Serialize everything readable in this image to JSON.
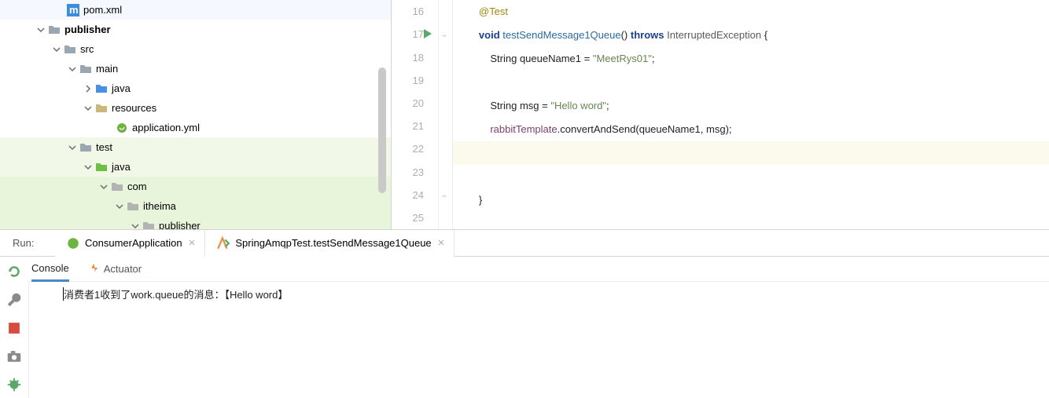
{
  "tree": {
    "pom": "pom.xml",
    "publisher": "publisher",
    "src": "src",
    "main": "main",
    "java1": "java",
    "resources": "resources",
    "app_yml": "application.yml",
    "test": "test",
    "java2": "java",
    "com": "com",
    "itheima": "itheima",
    "publisher2": "publisher"
  },
  "gutter": {
    "l16": "16",
    "l17": "17",
    "l18": "18",
    "l19": "19",
    "l20": "20",
    "l21": "21",
    "l22": "22",
    "l23": "23",
    "l24": "24",
    "l25": "25"
  },
  "code": {
    "anno": "@Test",
    "kw_void": "void",
    "fn": "testSendMessage1Queue",
    "kw_throws": "throws",
    "cls_exc": "InterruptedException",
    "kw_string1": "String",
    "var_q": "queueName1",
    "str_q": "\"MeetRys01\"",
    "kw_string2": "String",
    "var_msg": "msg",
    "str_msg": "\"Hello word\"",
    "rabbit": "rabbitTemplate",
    "convert": "convertAndSend",
    "arg1": "queueName1",
    "arg2": "msg"
  },
  "run": {
    "label": "Run:",
    "tab1": "ConsumerApplication",
    "tab2": "SpringAmqpTest.testSendMessage1Queue",
    "console_tab": "Console",
    "actuator_tab": "Actuator"
  },
  "console": {
    "line1": "消费者1收到了work.queue的消息：【Hello word】"
  }
}
